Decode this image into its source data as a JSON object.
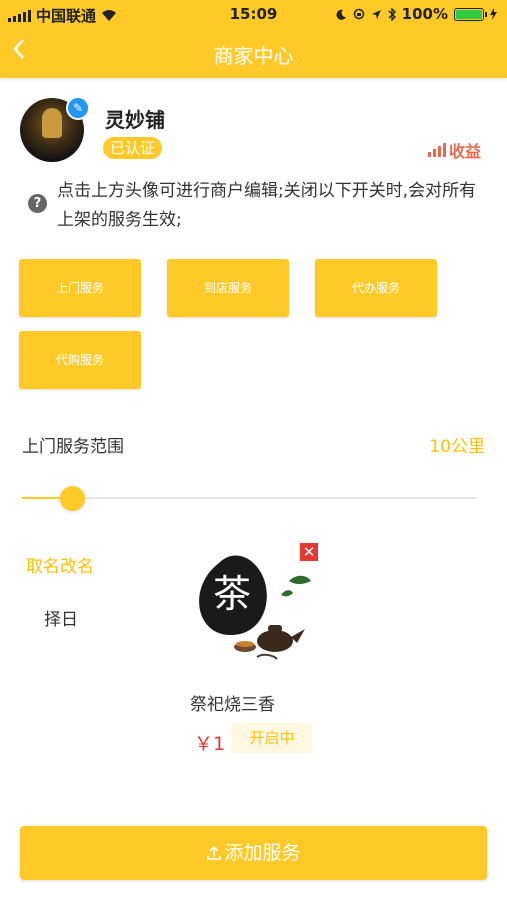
{
  "status_bar": {
    "carrier": "中国联通",
    "time": "15:09",
    "battery": "100%"
  },
  "nav": {
    "title": "商家中心",
    "back_icon": "chevron-left-icon"
  },
  "merchant": {
    "name": "灵妙铺",
    "verified_label": "已认证",
    "income_label": "收益",
    "help_text": "点击上方头像可进行商户编辑;关闭以下开关时,会对所有上架的服务生效;"
  },
  "services": [
    {
      "label": "上门服务"
    },
    {
      "label": "到店服务"
    },
    {
      "label": "代办服务"
    },
    {
      "label": "代购服务"
    }
  ],
  "range": {
    "label": "上门服务范围",
    "value_label": "10公里",
    "slider_fraction": 0.11
  },
  "categories": [
    {
      "label": "取名改名",
      "active": true
    },
    {
      "label": "择日",
      "active": false
    }
  ],
  "card": {
    "image_char": "茶",
    "title": "祭祀烧三香",
    "price": "￥1",
    "status": "开启中"
  },
  "add_button": {
    "label": "添加服务"
  },
  "colors": {
    "brand": "#FFCA28",
    "accent_text": "#FFC107",
    "price": "#e53935",
    "income": "#e86a4a"
  }
}
